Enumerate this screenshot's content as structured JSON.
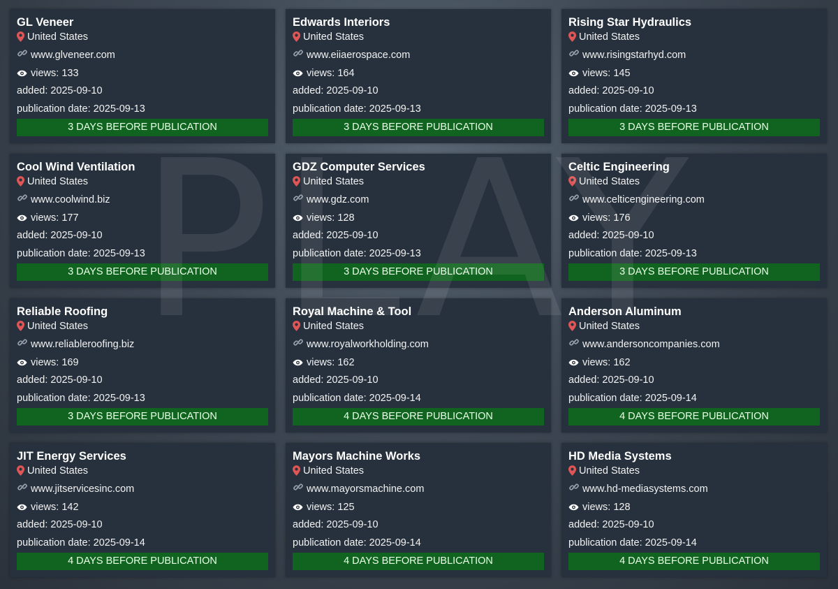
{
  "watermark": "PLAY",
  "colors": {
    "card_background": "#27313d",
    "status_bar": "#11641f",
    "pin": "#e05555"
  },
  "cards": [
    {
      "name": "GL Veneer",
      "country": "United States",
      "website": "www.glveneer.com",
      "views": "views: 133",
      "added": "added: 2025-09-10",
      "publication": "publication date: 2025-09-13",
      "status": "3 DAYS BEFORE PUBLICATION"
    },
    {
      "name": "Edwards Interiors",
      "country": "United States",
      "website": "www.eiiaerospace.com",
      "views": "views: 164",
      "added": "added: 2025-09-10",
      "publication": "publication date: 2025-09-13",
      "status": "3 DAYS BEFORE PUBLICATION"
    },
    {
      "name": "Rising Star Hydraulics",
      "country": "United States",
      "website": "www.risingstarhyd.com",
      "views": "views: 145",
      "added": "added: 2025-09-10",
      "publication": "publication date: 2025-09-13",
      "status": "3 DAYS BEFORE PUBLICATION"
    },
    {
      "name": "Cool Wind Ventilation",
      "country": "United States",
      "website": "www.coolwind.biz",
      "views": "views: 177",
      "added": "added: 2025-09-10",
      "publication": "publication date: 2025-09-13",
      "status": "3 DAYS BEFORE PUBLICATION"
    },
    {
      "name": "GDZ Computer Services",
      "country": "United States",
      "website": "www.gdz.com",
      "views": "views: 128",
      "added": "added: 2025-09-10",
      "publication": "publication date: 2025-09-13",
      "status": "3 DAYS BEFORE PUBLICATION"
    },
    {
      "name": "Celtic Engineering",
      "country": "United States",
      "website": "www.celticengineering.com",
      "views": "views: 176",
      "added": "added: 2025-09-10",
      "publication": "publication date: 2025-09-13",
      "status": "3 DAYS BEFORE PUBLICATION"
    },
    {
      "name": "Reliable Roofing",
      "country": "United States",
      "website": "www.reliableroofing.biz",
      "views": "views: 169",
      "added": "added: 2025-09-10",
      "publication": "publication date: 2025-09-13",
      "status": "3 DAYS BEFORE PUBLICATION"
    },
    {
      "name": "Royal Machine & Tool",
      "country": "United States",
      "website": "www.royalworkholding.com",
      "views": "views: 162",
      "added": "added: 2025-09-10",
      "publication": "publication date: 2025-09-14",
      "status": "4 DAYS BEFORE PUBLICATION"
    },
    {
      "name": "Anderson Aluminum",
      "country": "United States",
      "website": "www.andersoncompanies.com",
      "views": "views: 162",
      "added": "added: 2025-09-10",
      "publication": "publication date: 2025-09-14",
      "status": "4 DAYS BEFORE PUBLICATION"
    },
    {
      "name": "JIT Energy Services",
      "country": "United States",
      "website": "www.jitservicesinc.com",
      "views": "views: 142",
      "added": "added: 2025-09-10",
      "publication": "publication date: 2025-09-14",
      "status": "4 DAYS BEFORE PUBLICATION"
    },
    {
      "name": "Mayors Machine Works",
      "country": "United States",
      "website": "www.mayorsmachine.com",
      "views": "views: 125",
      "added": "added: 2025-09-10",
      "publication": "publication date: 2025-09-14",
      "status": "4 DAYS BEFORE PUBLICATION"
    },
    {
      "name": "HD Media Systems",
      "country": "United States",
      "website": "www.hd-mediasystems.com",
      "views": "views: 128",
      "added": "added: 2025-09-10",
      "publication": "publication date: 2025-09-14",
      "status": "4 DAYS BEFORE PUBLICATION"
    }
  ]
}
